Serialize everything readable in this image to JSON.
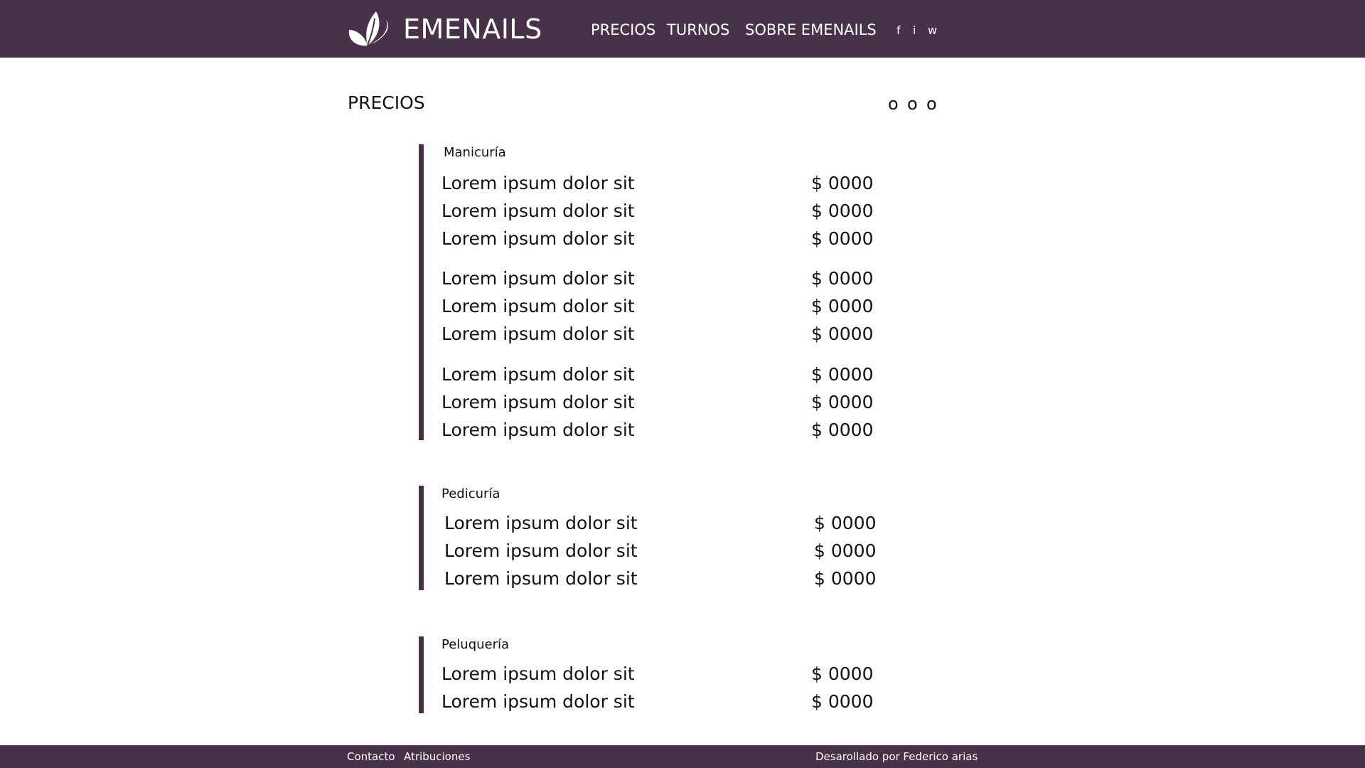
{
  "colors": {
    "brand": "#48324a",
    "background": "#ffffff",
    "text": "#111111",
    "nav_text": "#ffffff"
  },
  "header": {
    "logo_icon": "butterfly-icon",
    "brand": "EMENAILS",
    "nav": [
      "PRECIOS",
      "TURNOS",
      "SOBRE EMENAILS"
    ],
    "social": [
      "f",
      "i",
      "w"
    ]
  },
  "main": {
    "title": "PRECIOS",
    "dots": [
      "o",
      "o",
      "o"
    ],
    "sections": [
      {
        "title": "Manicuría",
        "rows": [
          {
            "label": "Lorem ipsum dolor sit",
            "price": "$ 0000"
          },
          {
            "label": "Lorem ipsum dolor sit",
            "price": "$ 0000"
          },
          {
            "label": "Lorem ipsum dolor sit",
            "price": "$ 0000"
          },
          {
            "label": "Lorem ipsum dolor sit",
            "price": "$ 0000"
          },
          {
            "label": "Lorem ipsum dolor sit",
            "price": "$ 0000"
          },
          {
            "label": "Lorem ipsum dolor sit",
            "price": "$ 0000"
          },
          {
            "label": "Lorem ipsum dolor sit",
            "price": "$ 0000"
          },
          {
            "label": "Lorem ipsum dolor sit",
            "price": "$ 0000"
          },
          {
            "label": "Lorem ipsum dolor sit",
            "price": "$ 0000"
          }
        ]
      },
      {
        "title": "Pedicuría",
        "rows": [
          {
            "label": "Lorem ipsum dolor sit",
            "price": "$ 0000"
          },
          {
            "label": "Lorem ipsum dolor sit",
            "price": "$ 0000"
          },
          {
            "label": "Lorem ipsum dolor sit",
            "price": "$ 0000"
          }
        ]
      },
      {
        "title": "Peluquería",
        "rows": [
          {
            "label": "Lorem ipsum dolor sit",
            "price": "$ 0000"
          },
          {
            "label": "Lorem ipsum dolor sit",
            "price": "$ 0000"
          }
        ]
      }
    ]
  },
  "footer": {
    "links": [
      "Contacto",
      "Atribuciones"
    ],
    "credit": "Desarollado por Federico arias"
  }
}
